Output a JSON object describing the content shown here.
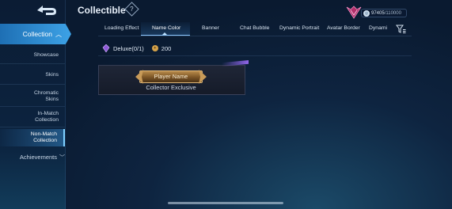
{
  "header": {
    "title": "Collectible",
    "help_glyph": "?",
    "currency": {
      "value": "97405",
      "max": "/110000",
      "coin_glyph": "◎"
    }
  },
  "sidebar": {
    "collection": "Collection",
    "items": [
      {
        "label": "Showcase"
      },
      {
        "label": "Skins"
      },
      {
        "label": "Chromatic Skins"
      },
      {
        "label": "In-Match Collection"
      },
      {
        "label": "Non-Match Collection",
        "active": true
      }
    ],
    "achievements": "Achievements"
  },
  "tabs": [
    {
      "label": "Loading Effect"
    },
    {
      "label": "Name Color",
      "active": true
    },
    {
      "label": "Banner"
    },
    {
      "label": "Chat Bubble"
    },
    {
      "label": "Dynamic Portrait"
    },
    {
      "label": "Avatar Border"
    },
    {
      "label": "Dynami"
    }
  ],
  "deluxe": {
    "label": "Deluxe(0/1)",
    "price": "200"
  },
  "card": {
    "preview_name": "Player Name",
    "caption": "Collector Exclusive"
  },
  "colors": {
    "accent": "#3da2e6",
    "active_tab_line": "#8ec8ff",
    "nameplate_gold": "#b88a4a"
  }
}
